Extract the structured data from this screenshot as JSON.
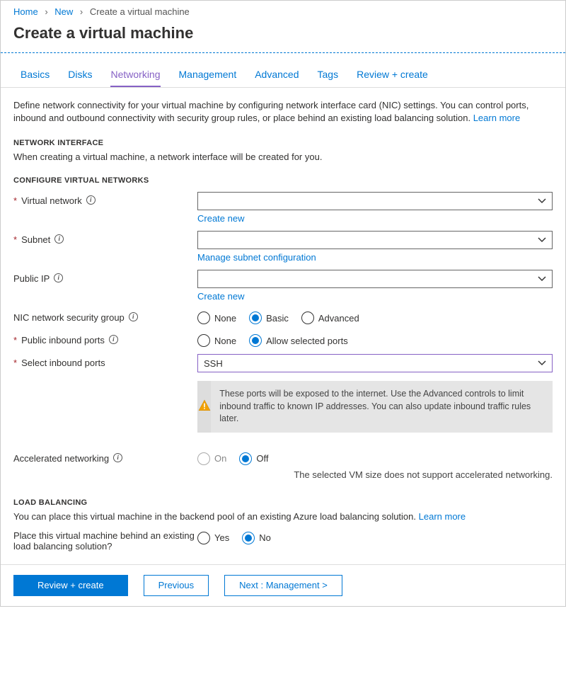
{
  "breadcrumb": {
    "home": "Home",
    "new": "New",
    "current": "Create a virtual machine"
  },
  "title": "Create a virtual machine",
  "tabs": [
    "Basics",
    "Disks",
    "Networking",
    "Management",
    "Advanced",
    "Tags",
    "Review + create"
  ],
  "activeTab": "Networking",
  "intro": {
    "text": "Define network connectivity for your virtual machine by configuring network interface card (NIC) settings. You can control ports, inbound and outbound connectivity with security group rules, or place behind an existing load balancing solution.  ",
    "learn": "Learn more"
  },
  "networkInterface": {
    "heading": "NETWORK INTERFACE",
    "text": "When creating a virtual machine, a network interface will be created for you."
  },
  "configure": {
    "heading": "CONFIGURE VIRTUAL NETWORKS",
    "virtualNetwork": {
      "label": "Virtual network",
      "createNew": "Create new"
    },
    "subnet": {
      "label": "Subnet",
      "manage": "Manage subnet configuration"
    },
    "publicIp": {
      "label": "Public IP",
      "createNew": "Create new"
    },
    "nsg": {
      "label": "NIC network security group",
      "options": [
        "None",
        "Basic",
        "Advanced"
      ],
      "selected": "Basic"
    },
    "inboundPorts": {
      "label": "Public inbound ports",
      "options": [
        "None",
        "Allow selected ports"
      ],
      "selected": "Allow selected ports"
    },
    "selectPorts": {
      "label": "Select inbound ports",
      "value": "SSH"
    },
    "warning": "These ports will be exposed to the internet. Use the Advanced controls to limit inbound traffic to known IP addresses. You can also update inbound traffic rules later.",
    "accelerated": {
      "label": "Accelerated networking",
      "options": [
        "On",
        "Off"
      ],
      "selected": "Off",
      "helper": "The selected VM size does not support accelerated networking."
    }
  },
  "loadBalancing": {
    "heading": "LOAD BALANCING",
    "text": "You can place this virtual machine in the backend pool of an existing Azure load balancing solution.  ",
    "learn": "Learn more",
    "placement": {
      "label": "Place this virtual machine behind an existing load balancing solution?",
      "options": [
        "Yes",
        "No"
      ],
      "selected": "No"
    }
  },
  "footer": {
    "review": "Review + create",
    "previous": "Previous",
    "next": "Next : Management >"
  }
}
